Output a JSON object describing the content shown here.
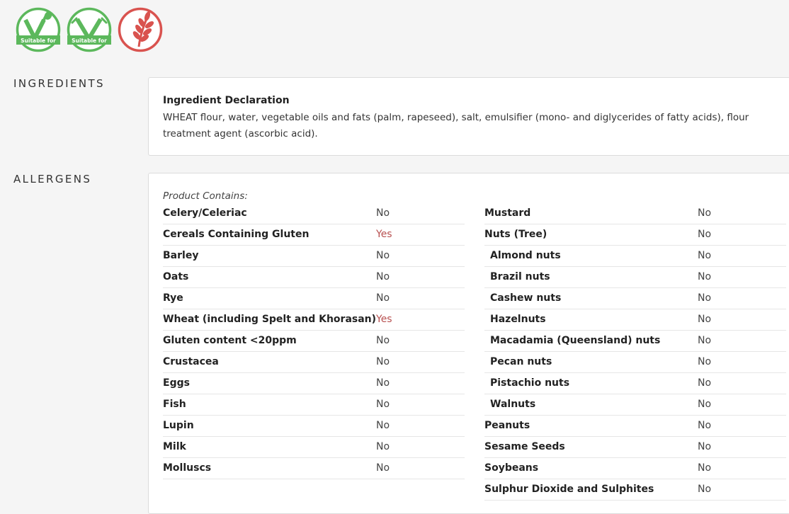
{
  "badges": [
    {
      "icon": "vegetarian-suitable-icon",
      "caption": "Suitable for",
      "color": "#5cb85c"
    },
    {
      "icon": "vegan-suitable-icon",
      "caption": "Suitable for",
      "color": "#5cb85c"
    },
    {
      "icon": "contains-gluten-wheat-icon",
      "caption": "",
      "color": "#d9534f"
    }
  ],
  "ingredients": {
    "section_label": "INGREDIENTS",
    "declaration_title": "Ingredient Declaration",
    "declaration_text": "WHEAT flour, water, vegetable oils and fats (palm, rapeseed), salt, emulsifier (mono- and diglycerides of fatty acids), flour treatment agent (ascorbic acid)."
  },
  "allergens": {
    "section_label": "ALLERGENS",
    "contains_label": "Product Contains:",
    "left": [
      {
        "name": "Celery/Celeriac",
        "value": "No"
      },
      {
        "name": "Cereals Containing Gluten",
        "value": "Yes"
      },
      {
        "name": "Barley",
        "value": "No"
      },
      {
        "name": "Oats",
        "value": "No"
      },
      {
        "name": "Rye",
        "value": "No"
      },
      {
        "name": "Wheat (including Spelt and Khorasan)",
        "value": "Yes"
      },
      {
        "name": "Gluten content <20ppm",
        "value": "No"
      },
      {
        "name": "Crustacea",
        "value": "No"
      },
      {
        "name": "Eggs",
        "value": "No"
      },
      {
        "name": "Fish",
        "value": "No"
      },
      {
        "name": "Lupin",
        "value": "No"
      },
      {
        "name": "Milk",
        "value": "No"
      },
      {
        "name": "Molluscs",
        "value": "No"
      }
    ],
    "right": [
      {
        "name": "Mustard",
        "value": "No"
      },
      {
        "name": "Nuts (Tree)",
        "value": "No"
      },
      {
        "name": "Almond nuts",
        "value": "No",
        "sub": true
      },
      {
        "name": "Brazil nuts",
        "value": "No",
        "sub": true
      },
      {
        "name": "Cashew nuts",
        "value": "No",
        "sub": true
      },
      {
        "name": "Hazelnuts",
        "value": "No",
        "sub": true
      },
      {
        "name": "Macadamia (Queensland) nuts",
        "value": "No",
        "sub": true
      },
      {
        "name": "Pecan nuts",
        "value": "No",
        "sub": true
      },
      {
        "name": "Pistachio nuts",
        "value": "No",
        "sub": true
      },
      {
        "name": "Walnuts",
        "value": "No",
        "sub": true
      },
      {
        "name": "Peanuts",
        "value": "No"
      },
      {
        "name": "Sesame Seeds",
        "value": "No"
      },
      {
        "name": "Soybeans",
        "value": "No"
      },
      {
        "name": "Sulphur Dioxide and Sulphites",
        "value": "No"
      }
    ]
  }
}
